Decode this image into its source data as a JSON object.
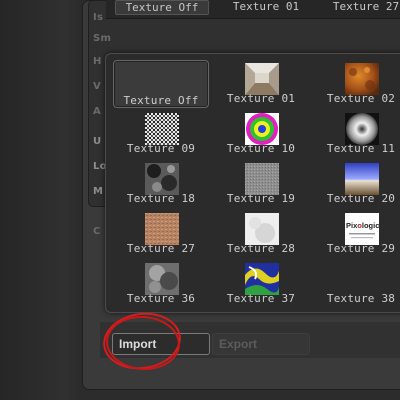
{
  "background_labels": [
    "Is",
    "Sm",
    "H",
    "V",
    "A",
    "U",
    "Lo",
    "M",
    "C"
  ],
  "top_row": [
    "Texture Off",
    "Texture 01",
    "Texture 27"
  ],
  "popup": {
    "cells": [
      {
        "label": "Texture Off",
        "icon": "empty-slot"
      },
      {
        "label": "Texture 01",
        "icon": "room-interior"
      },
      {
        "label": "Texture 02",
        "icon": "rust-orange"
      },
      {
        "label": "Texture 09",
        "icon": "black-white-noise"
      },
      {
        "label": "Texture 10",
        "icon": "rainbow-rings"
      },
      {
        "label": "Texture 11",
        "icon": "white-sphere"
      },
      {
        "label": "Texture 18",
        "icon": "dark-blotches"
      },
      {
        "label": "Texture 19",
        "icon": "gray-fine-noise"
      },
      {
        "label": "Texture 20",
        "icon": "sky-horizon"
      },
      {
        "label": "Texture 27",
        "icon": "tan-grain"
      },
      {
        "label": "Texture 28",
        "icon": "white-smudge"
      },
      {
        "label": "Texture 29",
        "icon": "pixologic-logo"
      },
      {
        "label": "Texture 36",
        "icon": "gray-cloud"
      },
      {
        "label": "Texture 37",
        "icon": "colorful-swirl"
      },
      {
        "label": "Texture 38",
        "icon": "dark-empty"
      }
    ],
    "logo_text": "Pixologic"
  },
  "buttons": {
    "import": "Import",
    "export": "Export"
  },
  "annotation_color": "#d41e1e"
}
